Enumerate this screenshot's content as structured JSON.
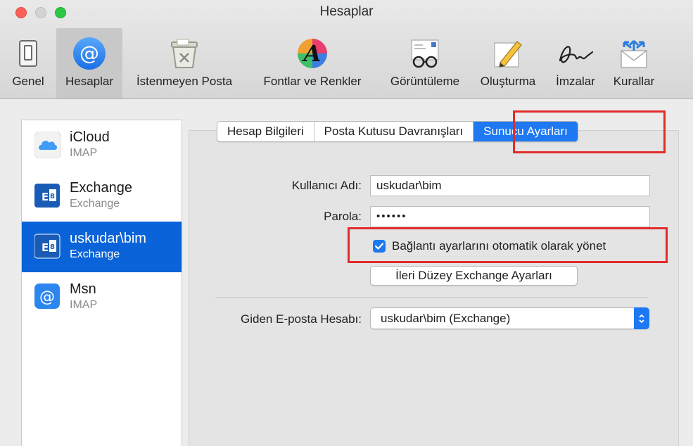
{
  "window": {
    "title": "Hesaplar"
  },
  "toolbar": {
    "items": [
      {
        "label": "Genel",
        "icon": "switch-icon"
      },
      {
        "label": "Hesaplar",
        "icon": "at-sign-icon",
        "selected": true
      },
      {
        "label": "İstenmeyen Posta",
        "icon": "junk-trash-icon"
      },
      {
        "label": "Fontlar ve Renkler",
        "icon": "font-colors-icon"
      },
      {
        "label": "Görüntüleme",
        "icon": "glasses-letter-icon"
      },
      {
        "label": "Oluşturma",
        "icon": "pencil-icon"
      },
      {
        "label": "İmzalar",
        "icon": "signature-icon"
      },
      {
        "label": "Kurallar",
        "icon": "rules-envelope-icon"
      }
    ]
  },
  "sidebar": {
    "accounts": [
      {
        "name": "iCloud",
        "type": "IMAP",
        "icon": "icloud-icon"
      },
      {
        "name": "Exchange",
        "type": "Exchange",
        "icon": "exchange-icon"
      },
      {
        "name": "uskudar\\bim",
        "type": "Exchange",
        "icon": "exchange-icon",
        "selected": true
      },
      {
        "name": "Msn",
        "type": "IMAP",
        "icon": "at-sign-icon"
      }
    ]
  },
  "tabs": [
    {
      "label": "Hesap Bilgileri"
    },
    {
      "label": "Posta Kutusu Davranışları"
    },
    {
      "label": "Sunucu Ayarları",
      "active": true
    }
  ],
  "form": {
    "username_label": "Kullanıcı Adı:",
    "username_value": "uskudar\\bim",
    "password_label": "Parola:",
    "password_value": "••••••",
    "auto_manage_label": "Bağlantı ayarlarını otomatik olarak yönet",
    "auto_manage_checked": true,
    "advanced_button": "İleri Düzey Exchange Ayarları",
    "outgoing_label": "Giden E-posta Hesabı:",
    "outgoing_value": "uskudar\\bim (Exchange)"
  },
  "colors": {
    "accent": "#1d78f2",
    "selection": "#0a63d8",
    "highlight_box": "#e22b2b"
  }
}
